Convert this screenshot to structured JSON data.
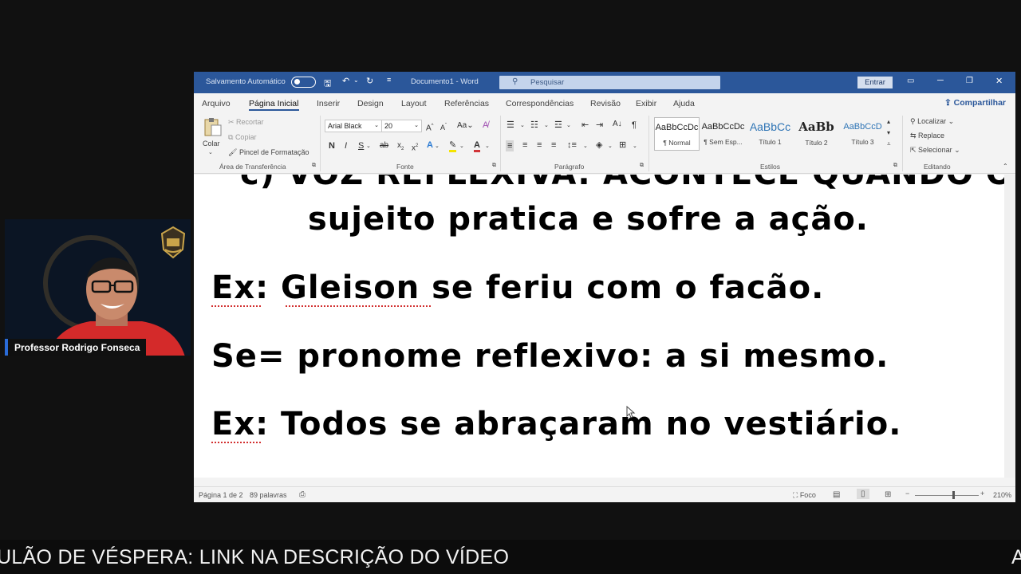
{
  "webcam": {
    "presenter_name": "Professor Rodrigo Fonseca"
  },
  "word": {
    "titlebar": {
      "autosave_label": "Salvamento Automático",
      "document_title": "Documento1  -  Word",
      "search_placeholder": "Pesquisar",
      "signin_label": "Entrar"
    },
    "tabs": [
      "Arquivo",
      "Página Inicial",
      "Inserir",
      "Design",
      "Layout",
      "Referências",
      "Correspondências",
      "Revisão",
      "Exibir",
      "Ajuda"
    ],
    "share_label": "Compartilhar",
    "ribbon": {
      "clipboard": {
        "paste": "Colar",
        "cut": "Recortar",
        "copy": "Copiar",
        "format_painter": "Pincel de Formatação",
        "group": "Área de Transferência"
      },
      "font": {
        "name": "Arial Black",
        "size": "20",
        "group": "Fonte"
      },
      "paragraph": {
        "group": "Parágrafo"
      },
      "styles": {
        "items": [
          {
            "preview": "AaBbCcDc",
            "name": "¶ Normal"
          },
          {
            "preview": "AaBbCcDc",
            "name": "¶ Sem Esp..."
          },
          {
            "preview": "AaBbCc",
            "name": "Título 1"
          },
          {
            "preview": "AaBb",
            "name": "Título 2"
          },
          {
            "preview": "AaBbCcD",
            "name": "Título 3"
          }
        ],
        "group": "Estilos"
      },
      "editing": {
        "find": "Localizar",
        "replace": "Replace",
        "select": "Selecionar",
        "group": "Editando"
      }
    },
    "document": {
      "lines": [
        "sujeito pratica e sofre a ação.",
        "Ex: Gleison se feriu com o facão.",
        "Se= pronome reflexivo: a si mesmo.",
        "Ex: Todos se abraçaram no vestiário."
      ],
      "partial_top_line": "c) VOZ REFLEXIVA: ACONTECE QUANDO O"
    },
    "statusbar": {
      "page": "Página 1 de 2",
      "words": "89 palavras",
      "focus": "Foco",
      "zoom": "210%",
      "zoom_fraction": 0.6
    }
  },
  "ticker": {
    "text": "ULÃO DE VÉSPERA: LINK NA DESCRIÇÃO DO VÍDEO",
    "next_fragment": "A"
  }
}
